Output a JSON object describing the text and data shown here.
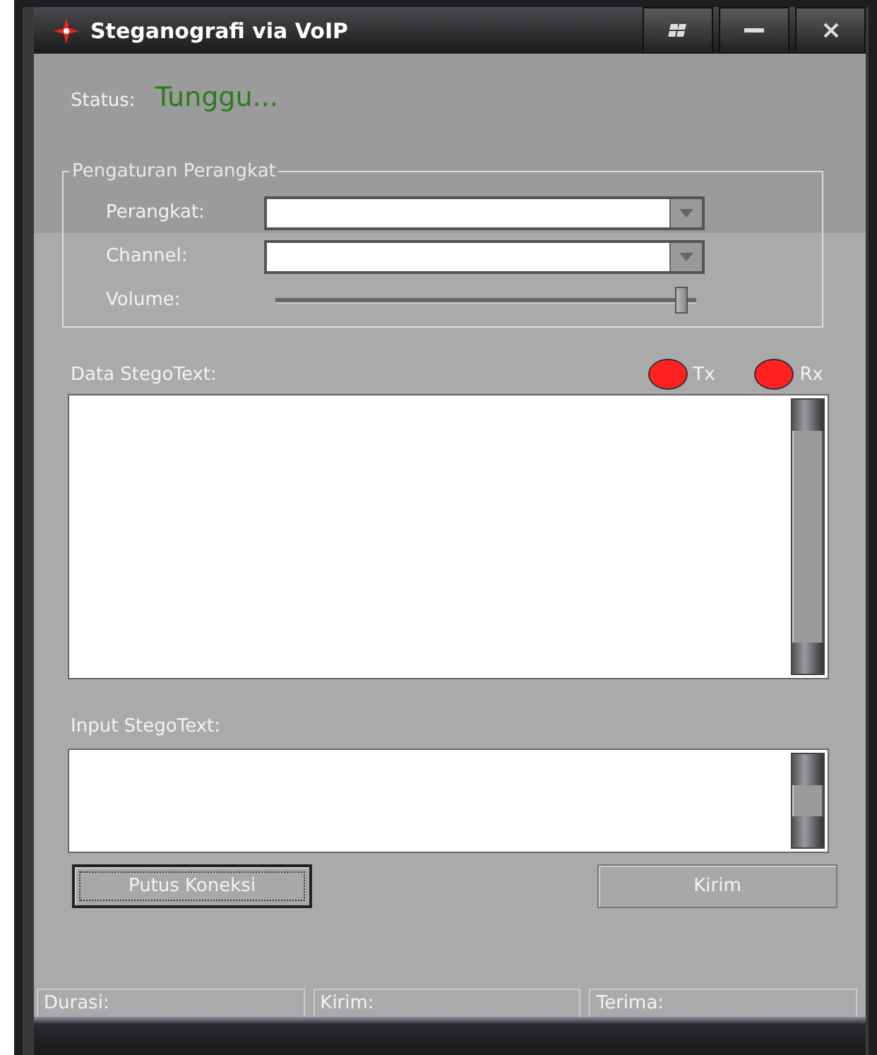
{
  "window": {
    "title": "Steganografi via VoIP"
  },
  "status": {
    "label": "Status:",
    "value": "Tunggu..."
  },
  "device_group": {
    "title": "Pengaturan Perangkat",
    "fields": [
      {
        "kind": "combo",
        "label": "Perangkat:"
      },
      {
        "kind": "combo",
        "label": "Channel:"
      },
      {
        "kind": "slider",
        "label": "Volume:",
        "level": 0.98
      }
    ]
  },
  "data_section": {
    "label": "Data StegoText:",
    "indicators": [
      {
        "label": "Tx",
        "color": "#ff2020"
      },
      {
        "label": "Rx",
        "color": "#ff2020"
      }
    ]
  },
  "input_section": {
    "label": "Input StegoText:"
  },
  "buttons": [
    {
      "label": "Putus Koneksi",
      "focused": true
    },
    {
      "label": "Kirim",
      "focused": false
    }
  ],
  "status_bar": [
    {
      "label": "Durasi:"
    },
    {
      "label": "Kirim:"
    },
    {
      "label": "Terima:"
    }
  ]
}
